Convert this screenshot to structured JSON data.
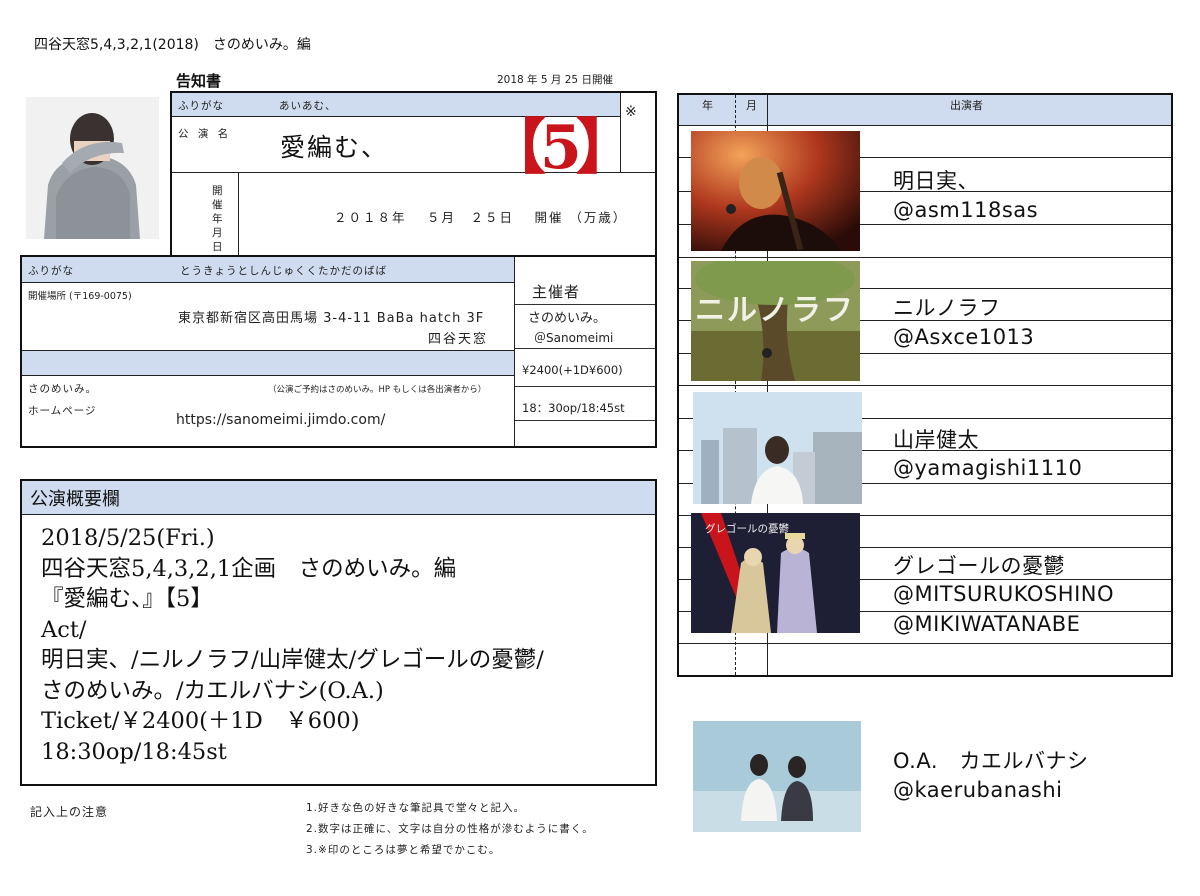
{
  "header": {
    "title": "四谷天窓5,4,3,2,1(2018)　さのめいみ。編",
    "doc_title": "告知書",
    "doc_date": "2018 年 5 月 25 日開催"
  },
  "form": {
    "furigana_label": "ふりがな",
    "furigana_value": "あいあむ、",
    "event_label": "公 演 名",
    "event_name": "愛編む、",
    "event_number": "【5】",
    "mark": "※",
    "date_label": "開催年月日",
    "date_value": "２０１８年　 ５月　２５日　 開催 （万歳）",
    "place_furigana_label": "ふりがな",
    "place_furigana_value": "とうきょうとしんじゅくくたかだのばば",
    "place_label": "開催場所 (〒169-0075)",
    "address": "東京都新宿区高田馬場 3-4-11 BaBa hatch 3F",
    "venue": "四谷天窓",
    "organizer_label": "主催者",
    "organizer_name": "さのめいみ。",
    "organizer_handle": "＠Sanomeimi",
    "ticket": "¥2400(+1D¥600)",
    "time": "18：30op/18:45st",
    "reserve_name": "さのめいみ。",
    "reserve_note": "（公演ご予約はさのめいみ。HP もしくは各出演者から）",
    "homepage_label": "ホームページ",
    "homepage_url": "https://sanomeimi.jimdo.com/"
  },
  "overview": {
    "title": "公演概要欄",
    "lines": [
      "2018/5/25(Fri.)",
      "四谷天窓5,4,3,2,1企画　さのめいみ。編",
      "『愛編む、』【5】",
      "Act/",
      "明日実、/ニルノラフ/山岸健太/グレゴールの憂鬱/",
      "さのめいみ。/カエルバナシ(O.A.)",
      "Ticket/￥2400(＋1D　￥600)",
      "18:30op/18:45st"
    ]
  },
  "notes": {
    "label": "記入上の注意",
    "items": [
      "1.好きな色の好きな筆記具で堂々と記入。",
      "2.数字は正確に、文字は自分の性格が滲むように書く。",
      "3.※印のところは夢と希望でかこむ。"
    ]
  },
  "performers_table": {
    "col_year": "年",
    "col_month": "月",
    "col_performers": "出演者",
    "performers": [
      {
        "name": "明日実、",
        "handle": "@asm118sas",
        "handle2": ""
      },
      {
        "name": "ニルノラフ",
        "handle": "@Asxce1013",
        "handle2": ""
      },
      {
        "name": "山岸健太",
        "handle": "@yamagishi1110",
        "handle2": ""
      },
      {
        "name": "グレゴールの憂鬱",
        "handle": "@MITSURUKOSHINO",
        "handle2": "@MIKIWATANABE"
      }
    ],
    "artwork_texts": [
      "ニルノラフ",
      "グレゴールの憂鬱"
    ]
  },
  "opening_act": {
    "name": "O.A.　カエルバナシ",
    "handle": "@kaerubanashi"
  },
  "colors": {
    "header_blue": "#cfdcef",
    "stamp_red": "#c8141a"
  }
}
